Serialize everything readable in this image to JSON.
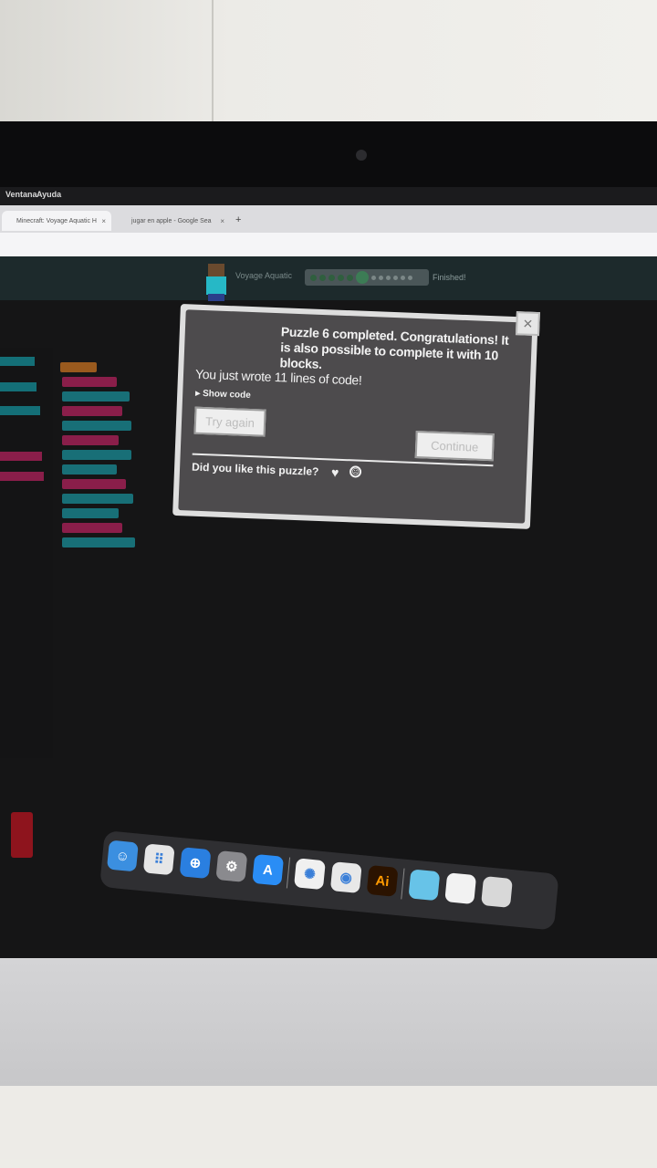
{
  "menubar": {
    "items": [
      "Ventana",
      "Ayuda"
    ]
  },
  "browser": {
    "tabs": [
      {
        "label": "Minecraft: Voyage Aquatic H"
      },
      {
        "label": "jugar en apple - Google Sea"
      }
    ],
    "new_tab": "+"
  },
  "app": {
    "title": "Voyage Aquatic",
    "status": "Finished!",
    "progress": {
      "completed": 5,
      "current": 6,
      "total": 12
    }
  },
  "dialog": {
    "message": "Puzzle 6 completed. Congratulations! It is also possible to complete it with 10 blocks.",
    "lines_message": "You just wrote 11 lines of code!",
    "show_code": "Show code",
    "try_again": "Try again",
    "continue": "Continue",
    "feedback_prompt": "Did you like this puzzle?",
    "close": "×"
  },
  "dock": {
    "items": [
      {
        "icon": "finder-icon",
        "glyph": "☺",
        "color": "#3b8fe0"
      },
      {
        "icon": "launchpad-icon",
        "glyph": "⠿",
        "color": "#e6e6e6"
      },
      {
        "icon": "safari-icon",
        "glyph": "⊕",
        "color": "#2a7fe0"
      },
      {
        "icon": "system-preferences-icon",
        "glyph": "⚙",
        "color": "#8a8a8e"
      },
      {
        "icon": "app-store-icon",
        "glyph": "A",
        "color": "#2a8df5"
      },
      {
        "icon": "sunflower-icon",
        "glyph": "✺",
        "color": "#f0f0f0"
      },
      {
        "icon": "chrome-icon",
        "glyph": "◉",
        "color": "#e8e8e8"
      },
      {
        "icon": "illustrator-icon",
        "glyph": "Ai",
        "color": "#2b1300"
      },
      {
        "icon": "folder-icon",
        "glyph": "",
        "color": "#67c3e8"
      },
      {
        "icon": "document-icon",
        "glyph": "",
        "color": "#f2f2f2"
      },
      {
        "icon": "trash-icon",
        "glyph": "",
        "color": "#d8d8d8"
      }
    ]
  }
}
